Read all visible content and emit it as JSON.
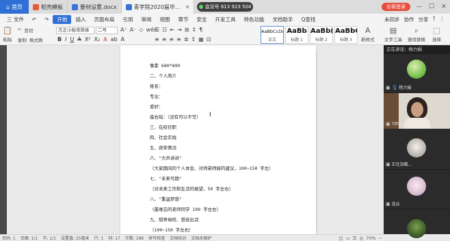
{
  "tabs": {
    "home": "首页",
    "items": [
      {
        "title": "稻壳模板",
        "color": "#e85a3a"
      },
      {
        "title": "要材设置.docx",
        "color": "#3b73d8"
      },
      {
        "title": "青字院2020届毕...",
        "color": "#3b73d8"
      }
    ],
    "meeting": "会议号 613 923 504",
    "login": "访客登录"
  },
  "menu": {
    "file": "三 文件",
    "items": [
      "开始",
      "插入",
      "页面布局",
      "引用",
      "审阅",
      "视图",
      "章节",
      "安全",
      "开发工具",
      "特色功能",
      "文档助手"
    ],
    "search": "Q查找",
    "right": [
      "未同步",
      "协作",
      "分享"
    ]
  },
  "ribbon": {
    "paste": "粘贴",
    "cut": "剪切",
    "copy": "复制",
    "format_painter": "格式刷",
    "font_name": "方正小标宋简体",
    "font_size": "二号",
    "styles": [
      {
        "sample": "AaBbCcDd",
        "name": "正文",
        "big": false
      },
      {
        "sample": "AaBb",
        "name": "标题 1",
        "big": true
      },
      {
        "sample": "AaBb(",
        "name": "标题 2",
        "big": true
      },
      {
        "sample": "AaBbC",
        "name": "标题 3",
        "big": true
      }
    ],
    "new_style": "新样式",
    "text_tools": "文字工具",
    "find_replace": "查找替换",
    "select": "选择"
  },
  "document": {
    "lines": [
      "像素 680*899",
      "二、个人简介",
      "姓名：",
      "专业：",
      "爱好：",
      "座右铭：（没有可以不写）",
      "三、在校任职",
      "四、社会实践",
      "五、获奖情况",
      "六、\"大声讲讲\"",
      "（大家期间的个人体会、对师弟师妹的建议，100~150 字左）",
      "七、\"未来可期\"",
      "（对未来工作和生活的展望，50 字左右）",
      "八、\"重温梦想\"",
      "（最难忘的老师同学 100 字左右）",
      "九、想寄母校、想说出话",
      "（100~150 字左右）"
    ]
  },
  "meeting_panel": {
    "speaking": "正在讲话：杨力娟",
    "participants": [
      {
        "name": "杨力娟",
        "avatar": "green-landscape"
      },
      {
        "name": "Tiffany向",
        "avatar": "video"
      },
      {
        "name": "正在加载...",
        "avatar": "cartoon"
      },
      {
        "name": "连云",
        "avatar": "anime"
      },
      {
        "name": "",
        "avatar": "plant"
      }
    ]
  },
  "status": {
    "items": [
      "页码: 1",
      "页面: 1/1",
      "节: 1/1",
      "设置值: 25毫米",
      "行: 1",
      "列: 17",
      "字数: 186",
      "拼写检查",
      "文档校对",
      "文档未保护"
    ],
    "zoom": "70%"
  }
}
